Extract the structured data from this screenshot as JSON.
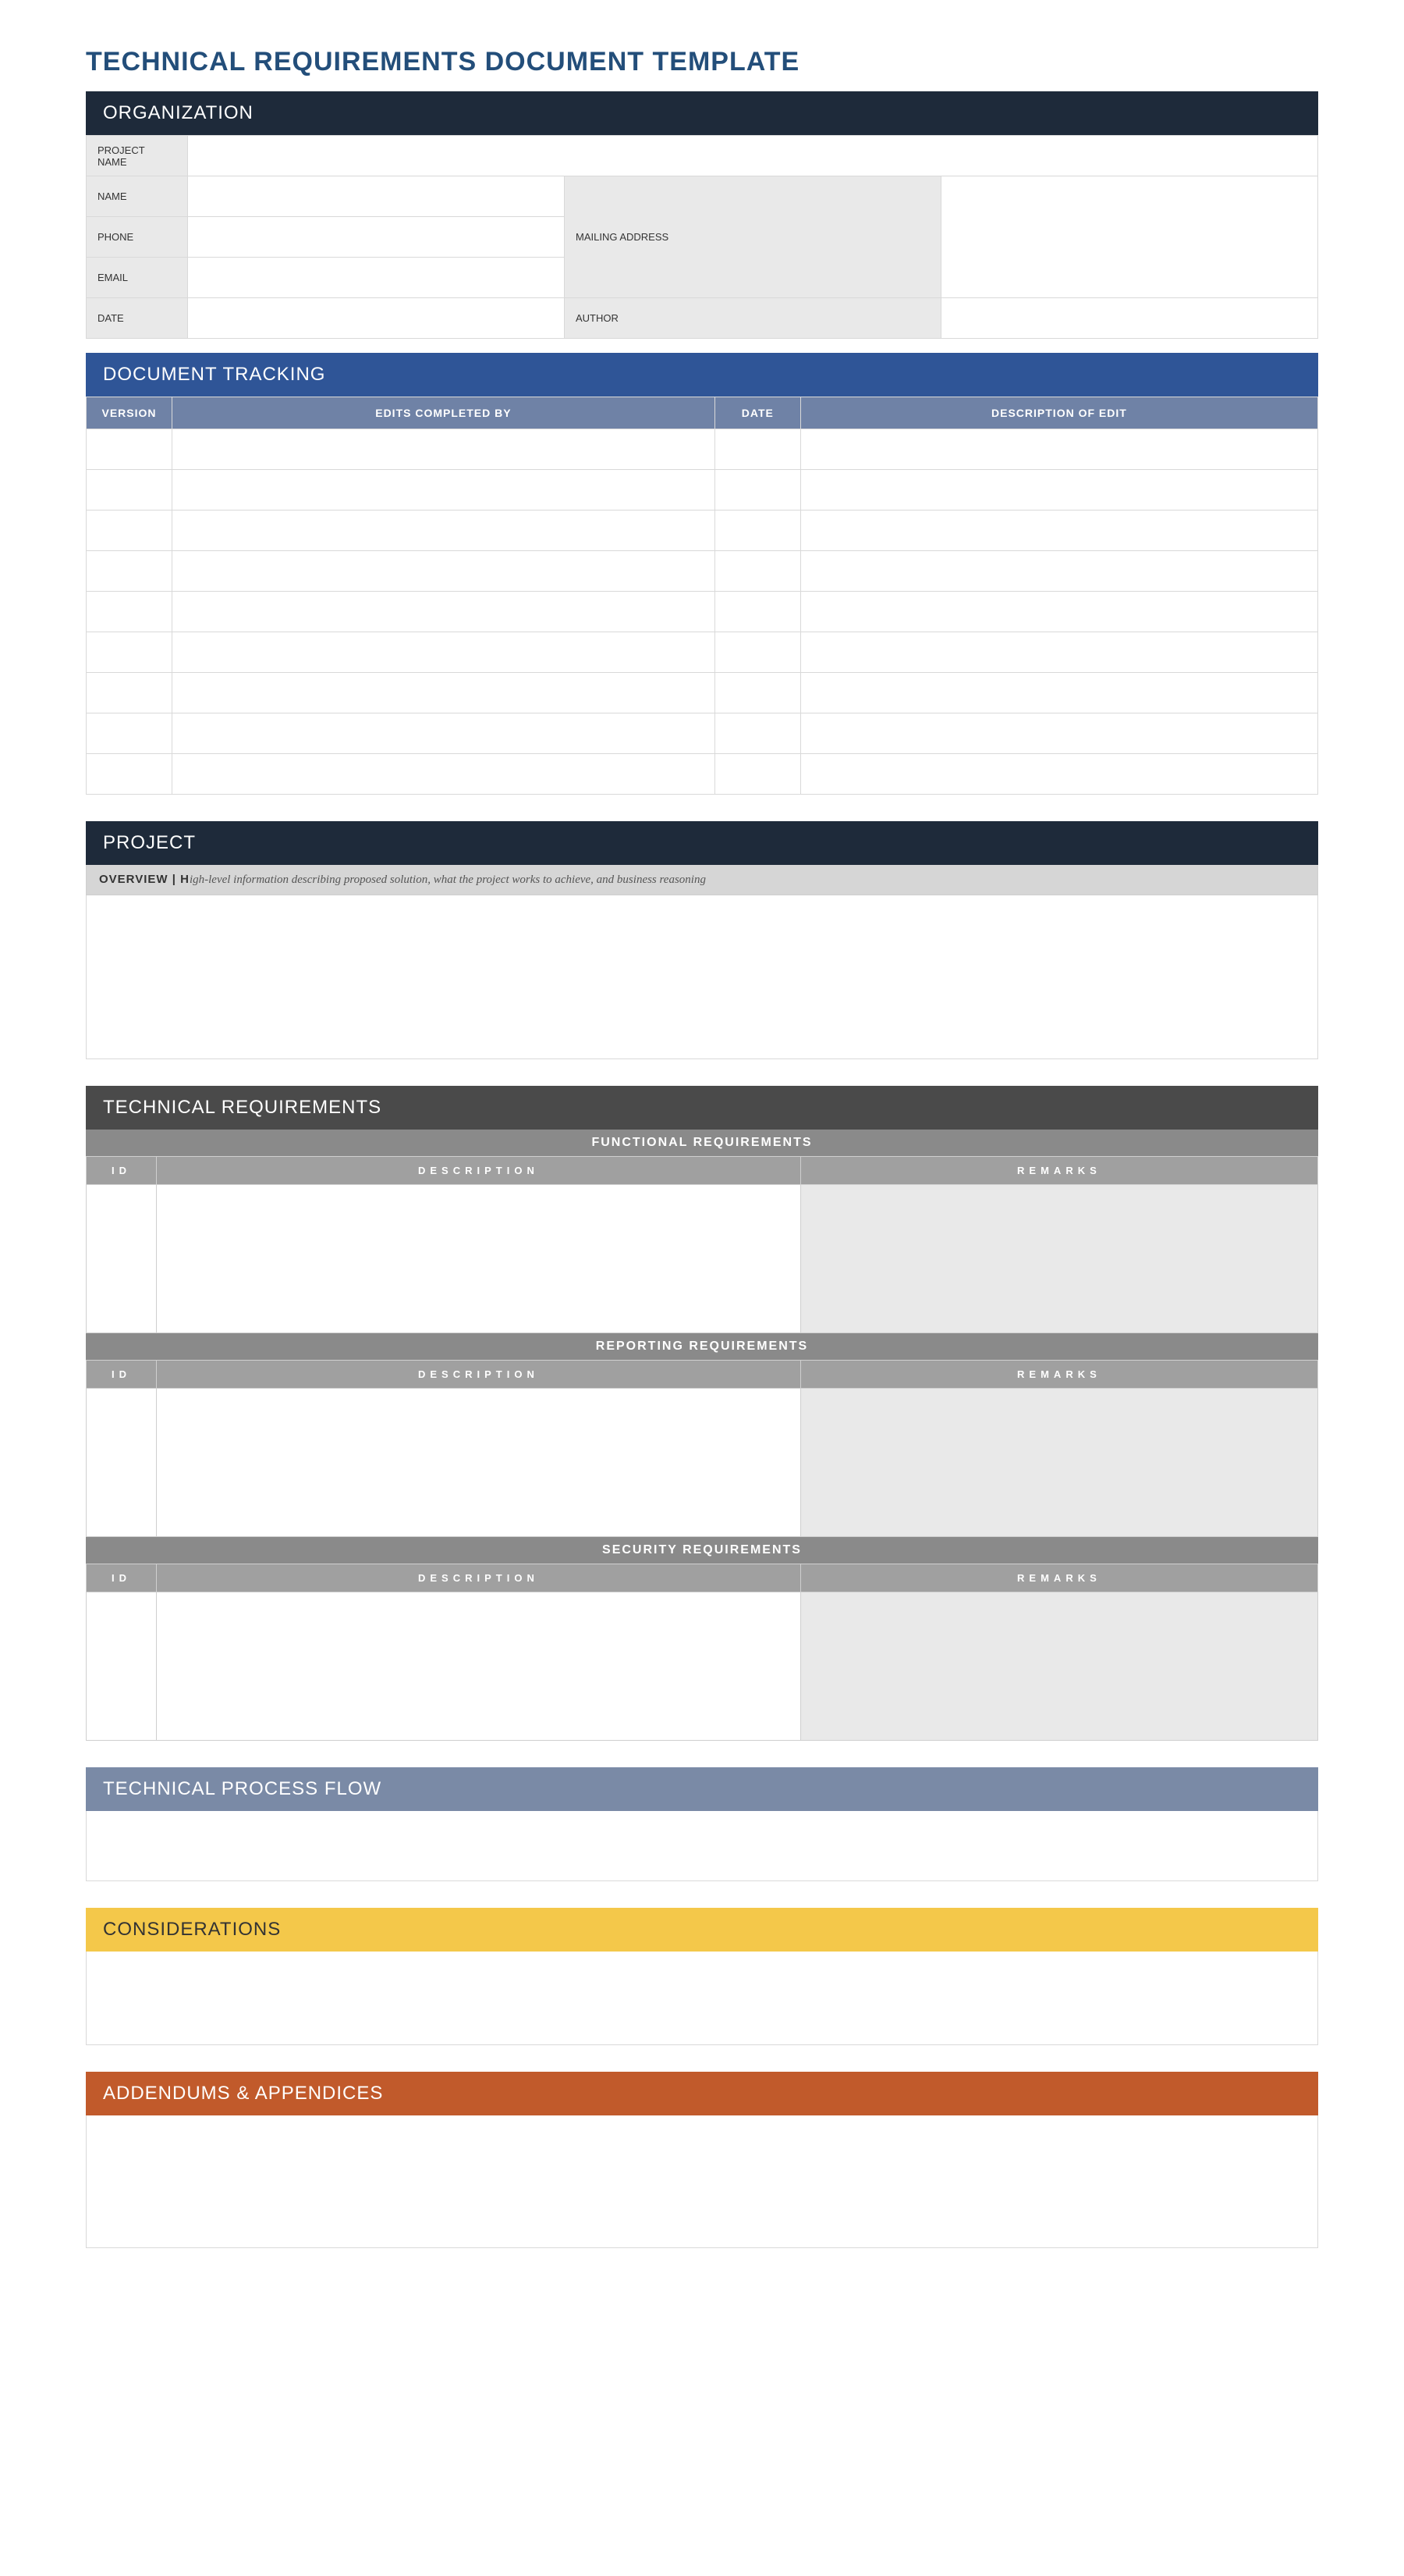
{
  "title": "TECHNICAL REQUIREMENTS DOCUMENT TEMPLATE",
  "organization": {
    "header": "ORGANIZATION",
    "labels": {
      "project_name": "PROJECT NAME",
      "name": "NAME",
      "phone": "PHONE",
      "email": "EMAIL",
      "date": "DATE",
      "mailing_address": "MAILING ADDRESS",
      "author": "AUTHOR"
    },
    "values": {
      "project_name": "",
      "name": "",
      "phone": "",
      "email": "",
      "date": "",
      "mailing_address": "",
      "author": ""
    }
  },
  "tracking": {
    "header": "DOCUMENT TRACKING",
    "columns": {
      "version": "VERSION",
      "edits_by": "EDITS COMPLETED BY",
      "date": "DATE",
      "description": "DESCRIPTION OF EDIT"
    },
    "rows": [
      {
        "version": "",
        "edits_by": "",
        "date": "",
        "description": ""
      },
      {
        "version": "",
        "edits_by": "",
        "date": "",
        "description": ""
      },
      {
        "version": "",
        "edits_by": "",
        "date": "",
        "description": ""
      },
      {
        "version": "",
        "edits_by": "",
        "date": "",
        "description": ""
      },
      {
        "version": "",
        "edits_by": "",
        "date": "",
        "description": ""
      },
      {
        "version": "",
        "edits_by": "",
        "date": "",
        "description": ""
      },
      {
        "version": "",
        "edits_by": "",
        "date": "",
        "description": ""
      },
      {
        "version": "",
        "edits_by": "",
        "date": "",
        "description": ""
      },
      {
        "version": "",
        "edits_by": "",
        "date": "",
        "description": ""
      }
    ]
  },
  "project": {
    "header": "PROJECT",
    "overview_label": "OVERVIEW  |  H",
    "overview_hint": "igh-level information describing proposed solution, what the project works to achieve, and business reasoning",
    "overview_body": ""
  },
  "tech": {
    "header": "TECHNICAL REQUIREMENTS",
    "columns": {
      "id": "ID",
      "description": "DESCRIPTION",
      "remarks": "REMARKS"
    },
    "sections": [
      {
        "title": "FUNCTIONAL REQUIREMENTS",
        "id": "",
        "description": "",
        "remarks": ""
      },
      {
        "title": "REPORTING REQUIREMENTS",
        "id": "",
        "description": "",
        "remarks": ""
      },
      {
        "title": "SECURITY REQUIREMENTS",
        "id": "",
        "description": "",
        "remarks": ""
      }
    ]
  },
  "flow": {
    "header": "TECHNICAL PROCESS FLOW",
    "body": ""
  },
  "consid": {
    "header": "CONSIDERATIONS",
    "body": ""
  },
  "addend": {
    "header": "ADDENDUMS & APPENDICES",
    "body": ""
  }
}
